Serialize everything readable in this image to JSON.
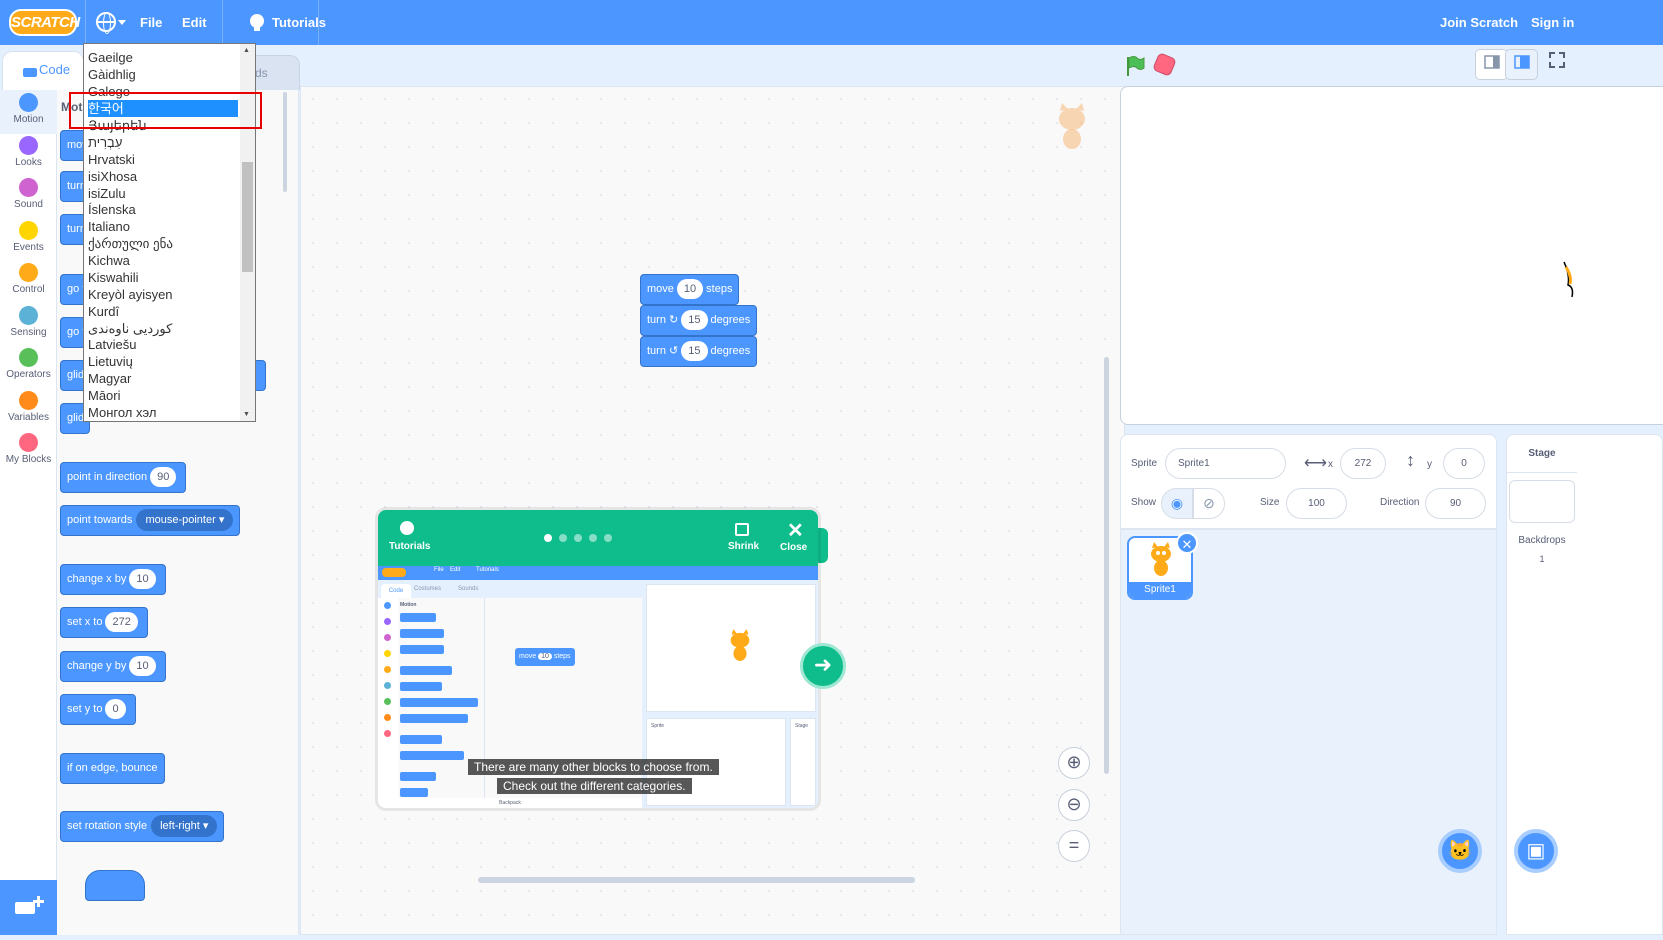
{
  "menubar": {
    "logo": "SCRATCH",
    "file": "File",
    "edit": "Edit",
    "tutorials": "Tutorials",
    "join": "Join Scratch",
    "signin": "Sign in"
  },
  "tabs": {
    "code": "Code",
    "other": "ds"
  },
  "categories": [
    {
      "label": "Motion",
      "color": "#4c97ff"
    },
    {
      "label": "Looks",
      "color": "#9966ff"
    },
    {
      "label": "Sound",
      "color": "#cf63cf"
    },
    {
      "label": "Events",
      "color": "#ffd500"
    },
    {
      "label": "Control",
      "color": "#ffab19"
    },
    {
      "label": "Sensing",
      "color": "#5cb1d6"
    },
    {
      "label": "Operators",
      "color": "#59c059"
    },
    {
      "label": "Variables",
      "color": "#ff8c1a"
    },
    {
      "label": "My Blocks",
      "color": "#ff6680"
    }
  ],
  "palette": {
    "section": "Mot",
    "mov": "mov",
    "turn1": "turn",
    "turn2": "turn",
    "goto1": "go t",
    "goto2": "go t",
    "glide1": "glid",
    "glide2": "glid",
    "point_dir": {
      "label": "point in direction",
      "value": "90"
    },
    "point_towards": {
      "label": "point towards",
      "value": "mouse-pointer"
    },
    "change_x": {
      "label": "change x by",
      "value": "10"
    },
    "set_x": {
      "label": "set x to",
      "value": "272"
    },
    "change_y": {
      "label": "change y by",
      "value": "10"
    },
    "set_y": {
      "label": "set y to",
      "value": "0"
    },
    "bounce": "if on edge, bounce",
    "rotation": {
      "label": "set rotation style",
      "value": "left-right"
    }
  },
  "workspace": {
    "move": {
      "label": "move",
      "value": "10",
      "suffix": "steps"
    },
    "turn_right": {
      "label": "turn",
      "value": "15",
      "suffix": "degrees"
    },
    "turn_left": {
      "label": "turn",
      "value": "15",
      "suffix": "degrees"
    }
  },
  "language_menu": {
    "items": [
      "Gaeilge",
      "Gàidhlig",
      "Galego",
      "한국어",
      "Յայերեն",
      "עִבְרִית",
      "Hrvatski",
      "isiXhosa",
      "isiZulu",
      "Íslenska",
      "Italiano",
      "ქართული ენა",
      "Kichwa",
      "Kiswahili",
      "Kreyòl ayisyen",
      "Kurdî",
      "کوردیی ناوەندی",
      "Latviešu",
      "Lietuvių",
      "Magyar",
      "Māori",
      "Монгол хэл"
    ],
    "selected": "한국어"
  },
  "tutorial": {
    "title": "Tutorials",
    "shrink": "Shrink",
    "close": "Close",
    "caption1": "There are many other blocks to choose from.",
    "caption2": "Check out the different categories.",
    "mini": {
      "file": "File",
      "edit": "Edit",
      "tutorials": "Tutorials",
      "code": "Code",
      "costumes": "Costumes",
      "sounds": "Sounds",
      "motion": "Motion",
      "move": "move",
      "steps": "steps",
      "value": "10",
      "backpack": "Backpack",
      "sprite": "Sprite",
      "stage": "Stage"
    }
  },
  "sprite_info": {
    "sprite_label": "Sprite",
    "sprite_name": "Sprite1",
    "x_label": "x",
    "x": "272",
    "y_label": "y",
    "y": "0",
    "show_label": "Show",
    "size_label": "Size",
    "size": "100",
    "direction_label": "Direction",
    "direction": "90"
  },
  "sprite_card": "Sprite1",
  "stage_pane": {
    "title": "Stage",
    "backdrops_label": "Backdrops",
    "backdrops_count": "1"
  },
  "icons": [
    "globe-icon",
    "lightbulb-icon",
    "green-flag-icon",
    "stop-icon",
    "zoom-in-icon",
    "zoom-out-icon",
    "zoom-reset-icon",
    "eye-icon",
    "hidden-icon",
    "trash-icon",
    "add-extension-icon",
    "choose-sprite-icon",
    "choose-backdrop-icon",
    "arrow-right-icon"
  ]
}
